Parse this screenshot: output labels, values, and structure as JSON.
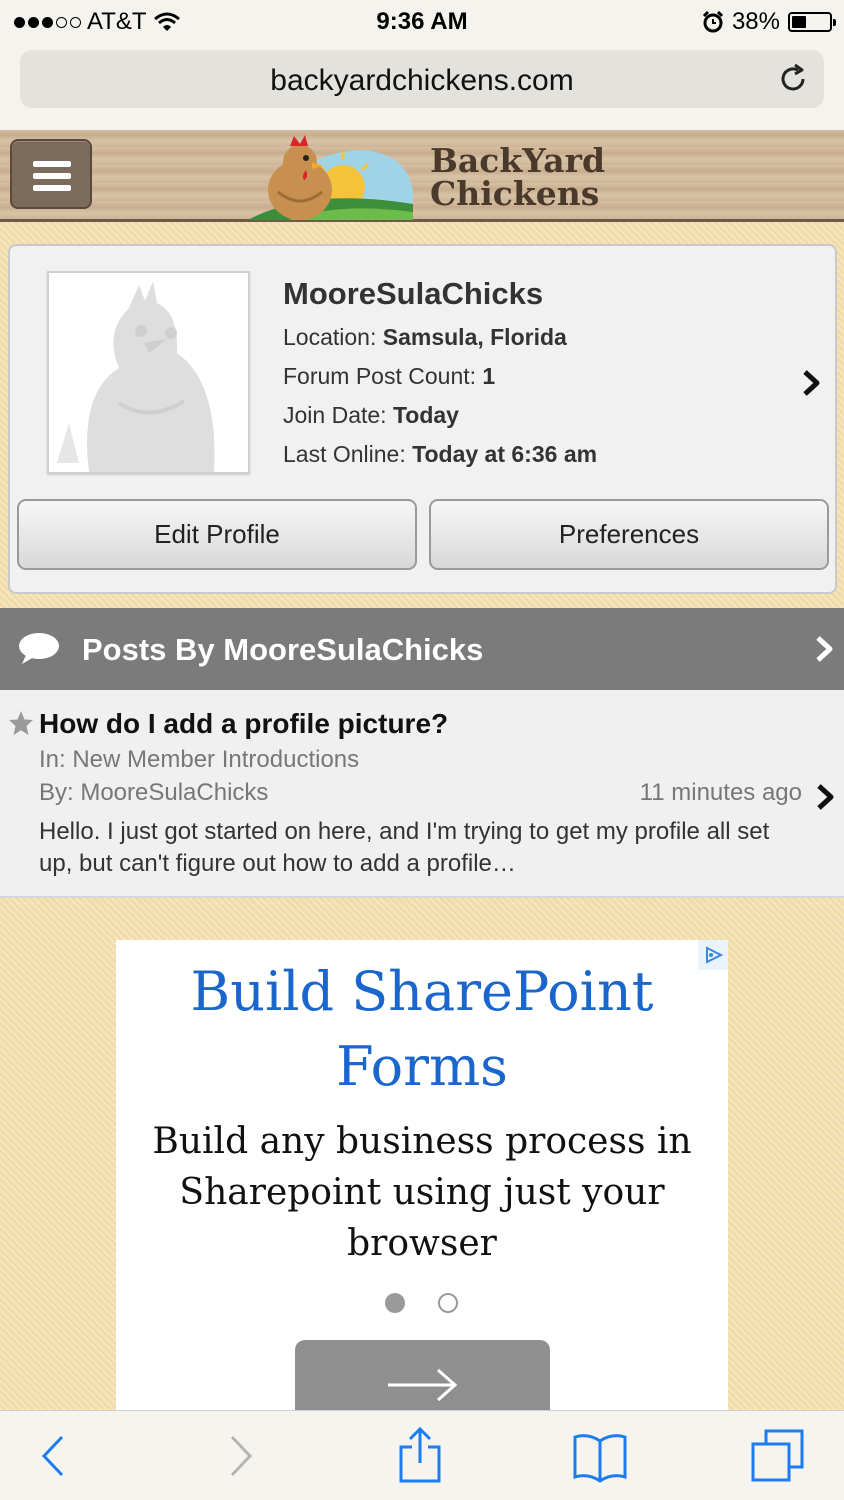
{
  "status_bar": {
    "carrier": "AT&T",
    "time": "9:36 AM",
    "battery": "38%",
    "signal_bars_filled": 3,
    "signal_bars_total": 5,
    "battery_level": 0.38
  },
  "browser": {
    "url": "backyardchickens.com"
  },
  "site": {
    "logo_line1": "BackYard",
    "logo_line2": "Chickens"
  },
  "profile": {
    "username": "MooreSulaChicks",
    "location_label": "Location:",
    "location_value": "Samsula, Florida",
    "post_count_label": "Forum Post Count:",
    "post_count_value": "1",
    "join_label": "Join Date:",
    "join_value": "Today",
    "last_online_label": "Last Online:",
    "last_online_value": "Today at 6:36 am",
    "edit_button": "Edit Profile",
    "prefs_button": "Preferences"
  },
  "posts_section": {
    "title": "Posts By MooreSulaChicks"
  },
  "posts": [
    {
      "title": "How do I add a profile picture?",
      "in": "In: New Member Introductions",
      "by": "By: MooreSulaChicks",
      "ago": "11 minutes ago",
      "excerpt": "Hello. I just got started on here, and I'm trying to get my profile all set up, but can't figure out how to add a profile…"
    }
  ],
  "ad": {
    "headline": "Build SharePoint Forms",
    "body": "Build any business process in Sharepoint using just your browser"
  },
  "colors": {
    "ad_headline": "#1a66cc",
    "posts_header_bg": "#7b7b7b",
    "page_pattern": "#f1dca9"
  }
}
